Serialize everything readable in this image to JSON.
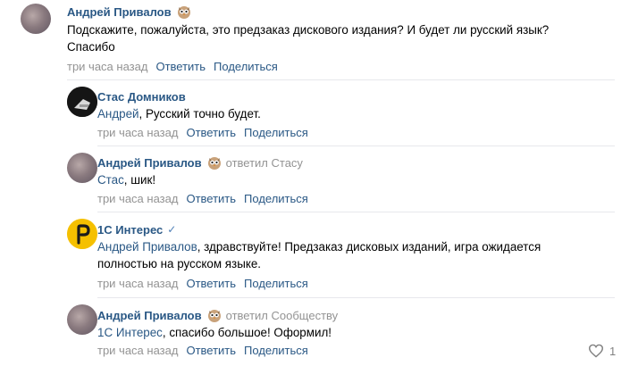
{
  "comments": [
    {
      "author": "Андрей Привалов",
      "emoji": "owl-emoji-icon",
      "text": "Подскажите, пожалуйста, это предзаказ дискового издания? И будет ли русский язык?",
      "text2": "Спасибо",
      "time": "три часа назад",
      "reply": "Ответить",
      "share": "Поделиться"
    },
    {
      "author": "Стас Домников",
      "mention": "Андрей",
      "text": ", Русский точно будет.",
      "time": "три часа назад",
      "reply": "Ответить",
      "share": "Поделиться"
    },
    {
      "author": "Андрей Привалов",
      "emoji": "owl-emoji-icon",
      "replied_to": "ответил Стасу",
      "mention": "Стас",
      "text": ", шик!",
      "time": "три часа назад",
      "reply": "Ответить",
      "share": "Поделиться"
    },
    {
      "author": "1С Интерес",
      "verified": "✓",
      "mention": "Андрей Привалов",
      "text": ", здравствуйте! Предзаказ дисковых изданий, игра ожидается",
      "text2": "полностью на русском языке.",
      "time": "три часа назад",
      "reply": "Ответить",
      "share": "Поделиться"
    },
    {
      "author": "Андрей Привалов",
      "emoji": "owl-emoji-icon",
      "replied_to": "ответил Сообществу",
      "mention": "1С Интерес",
      "text": ", спасибо большое! Оформил!",
      "time": "три часа назад",
      "reply": "Ответить",
      "share": "Поделиться",
      "likes": "1"
    }
  ]
}
